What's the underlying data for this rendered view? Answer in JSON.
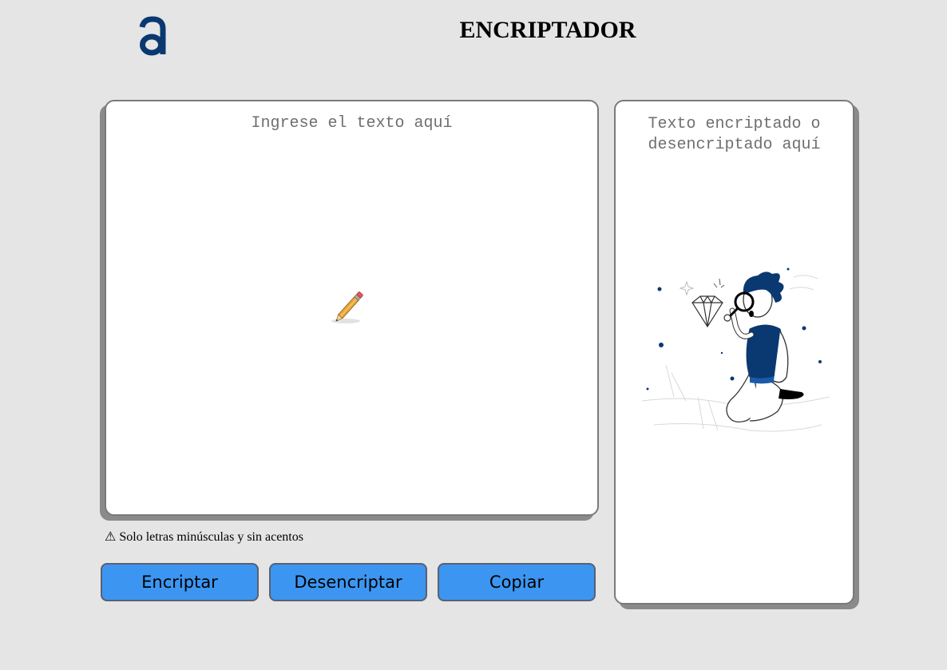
{
  "header": {
    "title": "ENCRIPTADOR"
  },
  "input": {
    "placeholder": "Ingrese el texto aquí",
    "value": ""
  },
  "warning": {
    "icon": "warning-icon",
    "text": "⚠ Solo letras minúsculas y sin acentos"
  },
  "buttons": {
    "encrypt": "Encriptar",
    "decrypt": "Desencriptar",
    "copy": "Copiar"
  },
  "output": {
    "placeholder": "Texto encriptado o desencriptado aquí"
  },
  "colors": {
    "background": "#e5e5e5",
    "button": "#3c96f1",
    "brand": "#0a3871",
    "card_border": "#7a7a7a"
  }
}
